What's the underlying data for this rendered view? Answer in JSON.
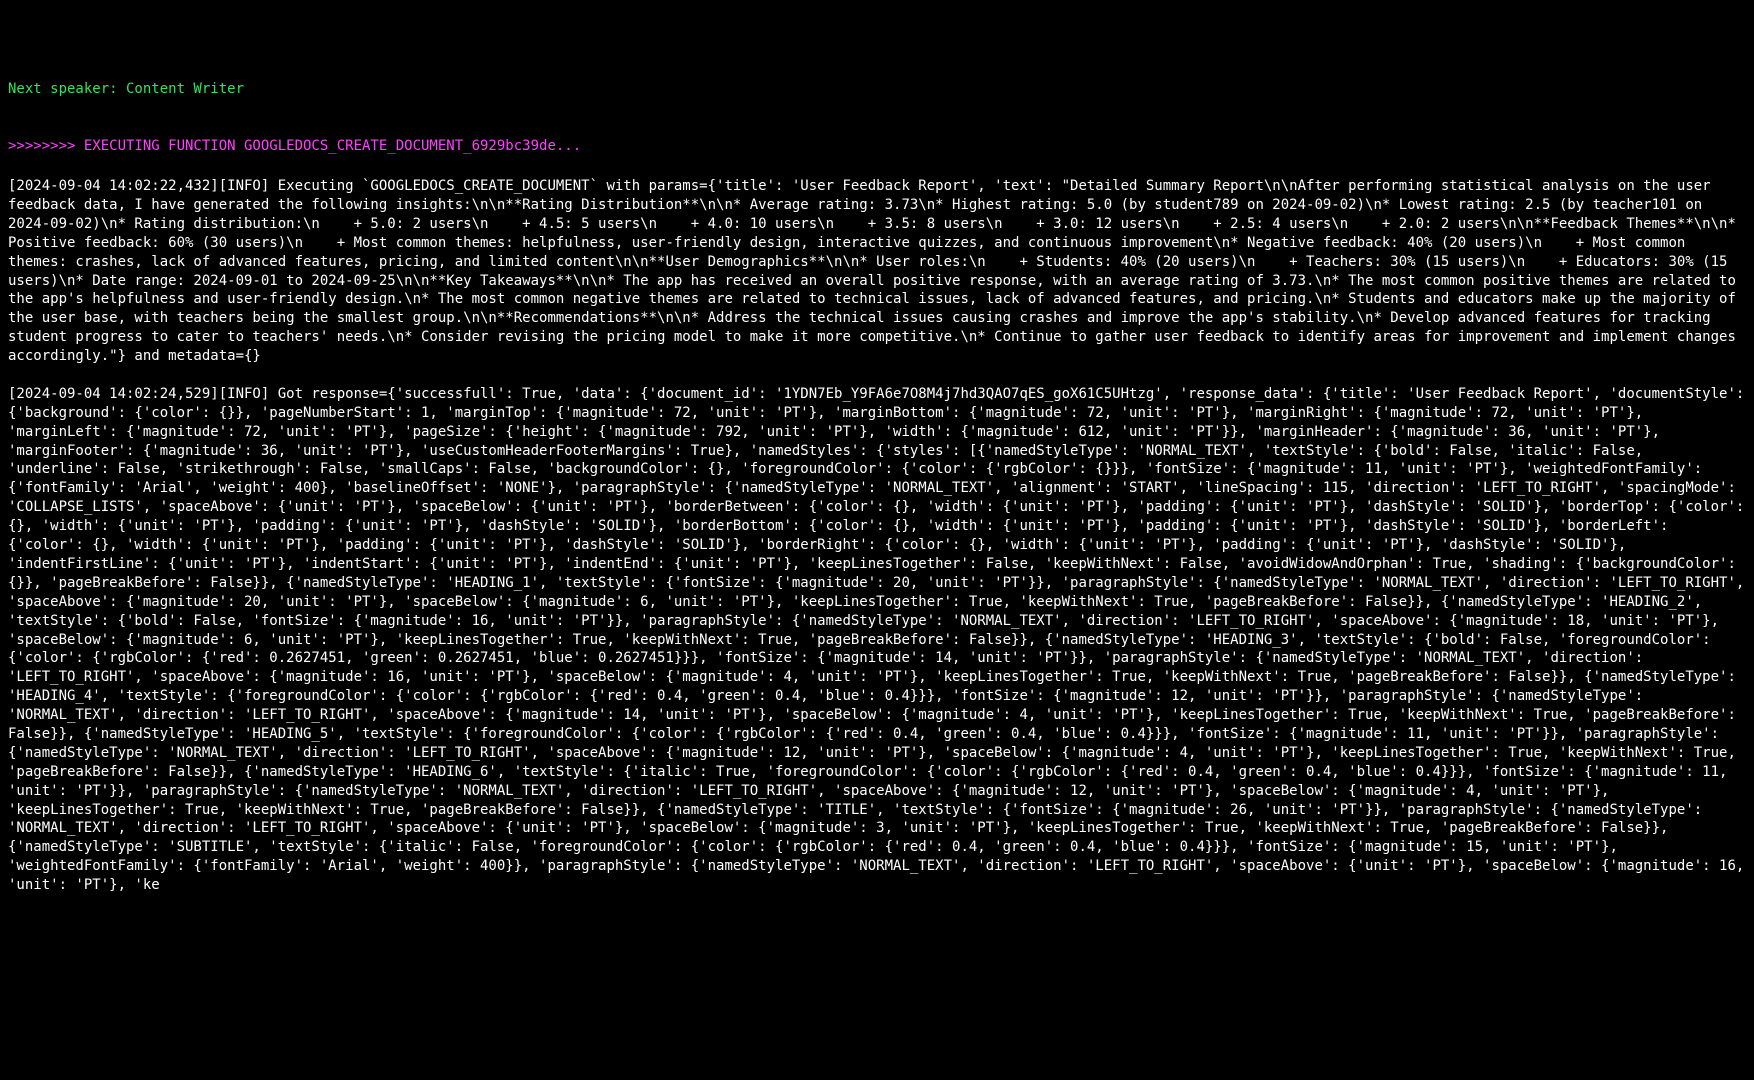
{
  "speaker": "Next speaker: Content Writer",
  "exec": ">>>>>>>> EXECUTING FUNCTION GOOGLEDOCS_CREATE_DOCUMENT_6929bc39de...",
  "log1": "[2024-09-04 14:02:22,432][INFO] Executing `GOOGLEDOCS_CREATE_DOCUMENT` with params={'title': 'User Feedback Report', 'text': \"Detailed Summary Report\\n\\nAfter performing statistical analysis on the user feedback data, I have generated the following insights:\\n\\n**Rating Distribution**\\n\\n* Average rating: 3.73\\n* Highest rating: 5.0 (by student789 on 2024-09-02)\\n* Lowest rating: 2.5 (by teacher101 on 2024-09-02)\\n* Rating distribution:\\n    + 5.0: 2 users\\n    + 4.5: 5 users\\n    + 4.0: 10 users\\n    + 3.5: 8 users\\n    + 3.0: 12 users\\n    + 2.5: 4 users\\n    + 2.0: 2 users\\n\\n**Feedback Themes**\\n\\n* Positive feedback: 60% (30 users)\\n    + Most common themes: helpfulness, user-friendly design, interactive quizzes, and continuous improvement\\n* Negative feedback: 40% (20 users)\\n    + Most common themes: crashes, lack of advanced features, pricing, and limited content\\n\\n**User Demographics**\\n\\n* User roles:\\n    + Students: 40% (20 users)\\n    + Teachers: 30% (15 users)\\n    + Educators: 30% (15 users)\\n* Date range: 2024-09-01 to 2024-09-25\\n\\n**Key Takeaways**\\n\\n* The app has received an overall positive response, with an average rating of 3.73.\\n* The most common positive themes are related to the app's helpfulness and user-friendly design.\\n* The most common negative themes are related to technical issues, lack of advanced features, and pricing.\\n* Students and educators make up the majority of the user base, with teachers being the smallest group.\\n\\n**Recommendations**\\n\\n* Address the technical issues causing crashes and improve the app's stability.\\n* Develop advanced features for tracking student progress to cater to teachers' needs.\\n* Consider revising the pricing model to make it more competitive.\\n* Continue to gather user feedback to identify areas for improvement and implement changes accordingly.\"} and metadata={}",
  "log2": "[2024-09-04 14:02:24,529][INFO] Got response={'successfull': True, 'data': {'document_id': '1YDN7Eb_Y9FA6e7O8M4j7hd3QAO7qES_goX61C5UHtzg', 'response_data': {'title': 'User Feedback Report', 'documentStyle': {'background': {'color': {}}, 'pageNumberStart': 1, 'marginTop': {'magnitude': 72, 'unit': 'PT'}, 'marginBottom': {'magnitude': 72, 'unit': 'PT'}, 'marginRight': {'magnitude': 72, 'unit': 'PT'}, 'marginLeft': {'magnitude': 72, 'unit': 'PT'}, 'pageSize': {'height': {'magnitude': 792, 'unit': 'PT'}, 'width': {'magnitude': 612, 'unit': 'PT'}}, 'marginHeader': {'magnitude': 36, 'unit': 'PT'}, 'marginFooter': {'magnitude': 36, 'unit': 'PT'}, 'useCustomHeaderFooterMargins': True}, 'namedStyles': {'styles': [{'namedStyleType': 'NORMAL_TEXT', 'textStyle': {'bold': False, 'italic': False, 'underline': False, 'strikethrough': False, 'smallCaps': False, 'backgroundColor': {}, 'foregroundColor': {'color': {'rgbColor': {}}}, 'fontSize': {'magnitude': 11, 'unit': 'PT'}, 'weightedFontFamily': {'fontFamily': 'Arial', 'weight': 400}, 'baselineOffset': 'NONE'}, 'paragraphStyle': {'namedStyleType': 'NORMAL_TEXT', 'alignment': 'START', 'lineSpacing': 115, 'direction': 'LEFT_TO_RIGHT', 'spacingMode': 'COLLAPSE_LISTS', 'spaceAbove': {'unit': 'PT'}, 'spaceBelow': {'unit': 'PT'}, 'borderBetween': {'color': {}, 'width': {'unit': 'PT'}, 'padding': {'unit': 'PT'}, 'dashStyle': 'SOLID'}, 'borderTop': {'color': {}, 'width': {'unit': 'PT'}, 'padding': {'unit': 'PT'}, 'dashStyle': 'SOLID'}, 'borderBottom': {'color': {}, 'width': {'unit': 'PT'}, 'padding': {'unit': 'PT'}, 'dashStyle': 'SOLID'}, 'borderLeft': {'color': {}, 'width': {'unit': 'PT'}, 'padding': {'unit': 'PT'}, 'dashStyle': 'SOLID'}, 'borderRight': {'color': {}, 'width': {'unit': 'PT'}, 'padding': {'unit': 'PT'}, 'dashStyle': 'SOLID'}, 'indentFirstLine': {'unit': 'PT'}, 'indentStart': {'unit': 'PT'}, 'indentEnd': {'unit': 'PT'}, 'keepLinesTogether': False, 'keepWithNext': False, 'avoidWidowAndOrphan': True, 'shading': {'backgroundColor': {}}, 'pageBreakBefore': False}}, {'namedStyleType': 'HEADING_1', 'textStyle': {'fontSize': {'magnitude': 20, 'unit': 'PT'}}, 'paragraphStyle': {'namedStyleType': 'NORMAL_TEXT', 'direction': 'LEFT_TO_RIGHT', 'spaceAbove': {'magnitude': 20, 'unit': 'PT'}, 'spaceBelow': {'magnitude': 6, 'unit': 'PT'}, 'keepLinesTogether': True, 'keepWithNext': True, 'pageBreakBefore': False}}, {'namedStyleType': 'HEADING_2', 'textStyle': {'bold': False, 'fontSize': {'magnitude': 16, 'unit': 'PT'}}, 'paragraphStyle': {'namedStyleType': 'NORMAL_TEXT', 'direction': 'LEFT_TO_RIGHT', 'spaceAbove': {'magnitude': 18, 'unit': 'PT'}, 'spaceBelow': {'magnitude': 6, 'unit': 'PT'}, 'keepLinesTogether': True, 'keepWithNext': True, 'pageBreakBefore': False}}, {'namedStyleType': 'HEADING_3', 'textStyle': {'bold': False, 'foregroundColor': {'color': {'rgbColor': {'red': 0.2627451, 'green': 0.2627451, 'blue': 0.2627451}}}, 'fontSize': {'magnitude': 14, 'unit': 'PT'}}, 'paragraphStyle': {'namedStyleType': 'NORMAL_TEXT', 'direction': 'LEFT_TO_RIGHT', 'spaceAbove': {'magnitude': 16, 'unit': 'PT'}, 'spaceBelow': {'magnitude': 4, 'unit': 'PT'}, 'keepLinesTogether': True, 'keepWithNext': True, 'pageBreakBefore': False}}, {'namedStyleType': 'HEADING_4', 'textStyle': {'foregroundColor': {'color': {'rgbColor': {'red': 0.4, 'green': 0.4, 'blue': 0.4}}}, 'fontSize': {'magnitude': 12, 'unit': 'PT'}}, 'paragraphStyle': {'namedStyleType': 'NORMAL_TEXT', 'direction': 'LEFT_TO_RIGHT', 'spaceAbove': {'magnitude': 14, 'unit': 'PT'}, 'spaceBelow': {'magnitude': 4, 'unit': 'PT'}, 'keepLinesTogether': True, 'keepWithNext': True, 'pageBreakBefore': False}}, {'namedStyleType': 'HEADING_5', 'textStyle': {'foregroundColor': {'color': {'rgbColor': {'red': 0.4, 'green': 0.4, 'blue': 0.4}}}, 'fontSize': {'magnitude': 11, 'unit': 'PT'}}, 'paragraphStyle': {'namedStyleType': 'NORMAL_TEXT', 'direction': 'LEFT_TO_RIGHT', 'spaceAbove': {'magnitude': 12, 'unit': 'PT'}, 'spaceBelow': {'magnitude': 4, 'unit': 'PT'}, 'keepLinesTogether': True, 'keepWithNext': True, 'pageBreakBefore': False}}, {'namedStyleType': 'HEADING_6', 'textStyle': {'italic': True, 'foregroundColor': {'color': {'rgbColor': {'red': 0.4, 'green': 0.4, 'blue': 0.4}}}, 'fontSize': {'magnitude': 11, 'unit': 'PT'}}, 'paragraphStyle': {'namedStyleType': 'NORMAL_TEXT', 'direction': 'LEFT_TO_RIGHT', 'spaceAbove': {'magnitude': 12, 'unit': 'PT'}, 'spaceBelow': {'magnitude': 4, 'unit': 'PT'}, 'keepLinesTogether': True, 'keepWithNext': True, 'pageBreakBefore': False}}, {'namedStyleType': 'TITLE', 'textStyle': {'fontSize': {'magnitude': 26, 'unit': 'PT'}}, 'paragraphStyle': {'namedStyleType': 'NORMAL_TEXT', 'direction': 'LEFT_TO_RIGHT', 'spaceAbove': {'unit': 'PT'}, 'spaceBelow': {'magnitude': 3, 'unit': 'PT'}, 'keepLinesTogether': True, 'keepWithNext': True, 'pageBreakBefore': False}}, {'namedStyleType': 'SUBTITLE', 'textStyle': {'italic': False, 'foregroundColor': {'color': {'rgbColor': {'red': 0.4, 'green': 0.4, 'blue': 0.4}}}, 'fontSize': {'magnitude': 15, 'unit': 'PT'}, 'weightedFontFamily': {'fontFamily': 'Arial', 'weight': 400}}, 'paragraphStyle': {'namedStyleType': 'NORMAL_TEXT', 'direction': 'LEFT_TO_RIGHT', 'spaceAbove': {'unit': 'PT'}, 'spaceBelow': {'magnitude': 16, 'unit': 'PT'}, 'ke"
}
